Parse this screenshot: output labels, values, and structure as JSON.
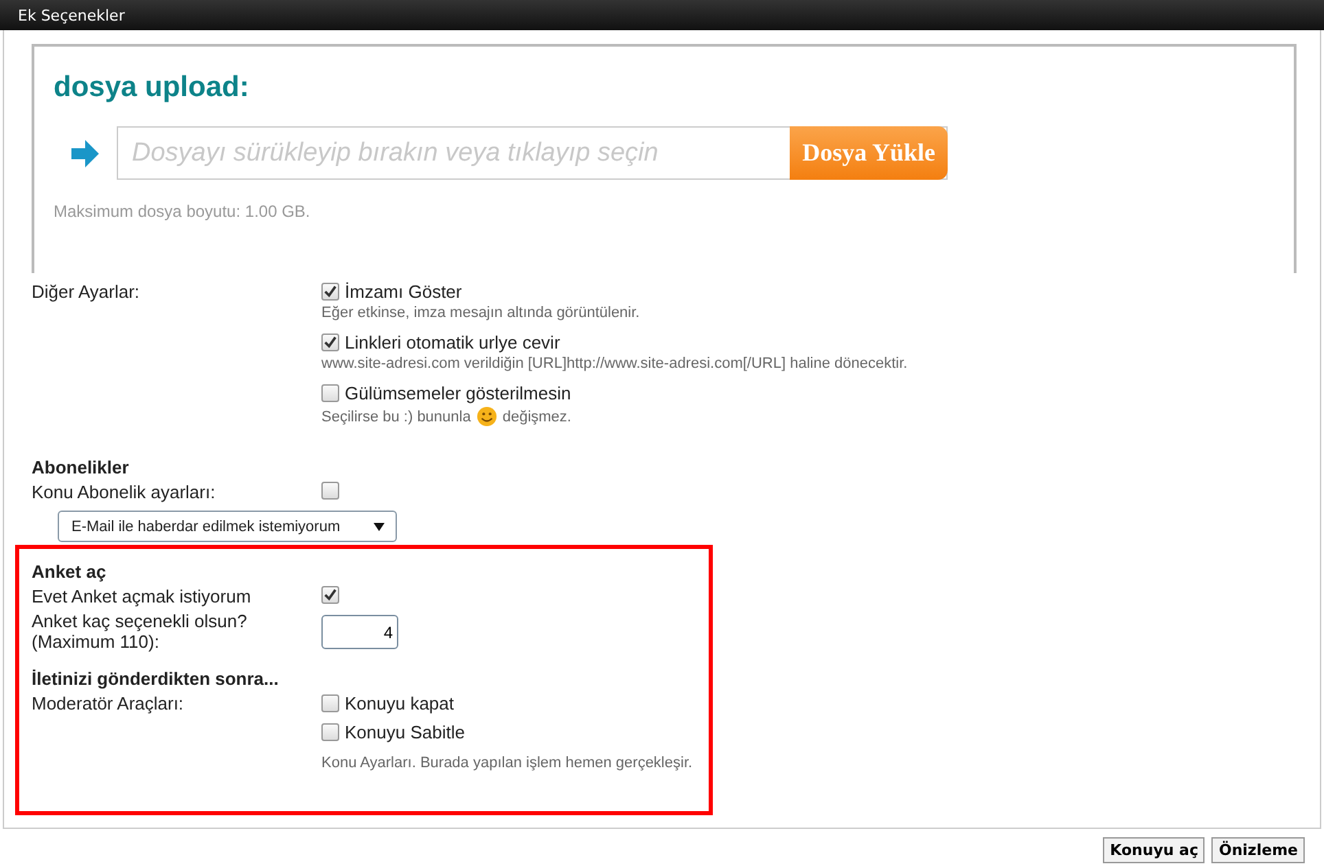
{
  "window": {
    "title": "Ek Seçenekler"
  },
  "upload": {
    "heading": "dosya upload:",
    "placeholder": "Dosyayı sürükleyip bırakın veya tıklayıp seçin",
    "button": "Dosya Yükle",
    "note": "Maksimum dosya boyutu: 1.00 GB."
  },
  "other_settings": {
    "label": "Diğer Ayarlar:",
    "options": [
      {
        "label": "İmzamı Göster",
        "checked": true,
        "hint": [
          "Eğer etkinse, imza mesajın altında görüntülenir."
        ]
      },
      {
        "label": "Linkleri otomatik urlye cevir",
        "checked": true,
        "hint": [
          "www.site-adresi.com verildiğin [URL]http://www.site-adresi.com[/URL] haline dönecektir."
        ]
      },
      {
        "label": "Gülümsemeler gösterilmesin",
        "checked": false,
        "hint": [
          "Seçilirse bu :) bununla",
          "değişmez."
        ]
      }
    ]
  },
  "subscriptions": {
    "heading": "Abonelikler",
    "label": "Konu Abonelik ayarları:",
    "checked": false,
    "select_value": "E-Mail ile haberdar edilmek istemiyorum"
  },
  "poll": {
    "heading": "Anket aç",
    "enable_label": "Evet Anket açmak istiyorum",
    "enabled": true,
    "count_label": [
      "Anket kaç seçenekli olsun?",
      "(Maximum 110):"
    ],
    "count_value": "4"
  },
  "after_post": {
    "heading": "İletinizi gönderdikten sonra...",
    "label": "Moderatör Araçları:",
    "options": [
      {
        "label": "Konuyu kapat",
        "checked": false
      },
      {
        "label": "Konuyu Sabitle",
        "checked": false
      }
    ],
    "note": "Konu Ayarları. Burada yapılan işlem hemen gerçekleşir."
  },
  "buttons": [
    "Konuyu aç",
    "Önizleme"
  ]
}
